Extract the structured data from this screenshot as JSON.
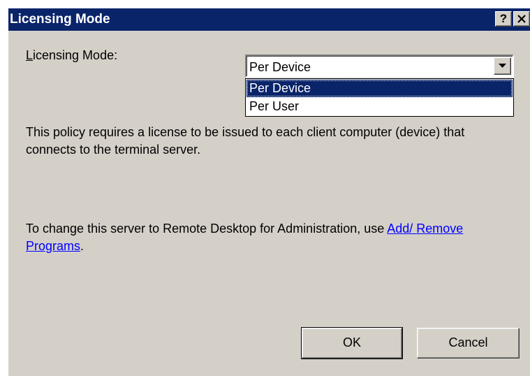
{
  "window": {
    "title": "Licensing Mode",
    "help_glyph": "?",
    "close_glyph": "✕"
  },
  "form": {
    "label_mnemonic": "L",
    "label_rest": "icensing Mode:",
    "selected_value": "Per Device",
    "options": [
      "Per Device",
      "Per User"
    ]
  },
  "description": "This policy requires a license to be issued to each client computer (device) that connects to the terminal server.",
  "admin_note": {
    "prefix": "To change this server to Remote Desktop for Administration, use ",
    "link_text": "Add/ Remove Programs",
    "suffix": "."
  },
  "buttons": {
    "ok": "OK",
    "cancel": "Cancel"
  },
  "colors": {
    "title_bar": "#0a246a",
    "dialog_face": "#d4d0c8",
    "selection": "#0a246a",
    "link": "#0000ff"
  }
}
